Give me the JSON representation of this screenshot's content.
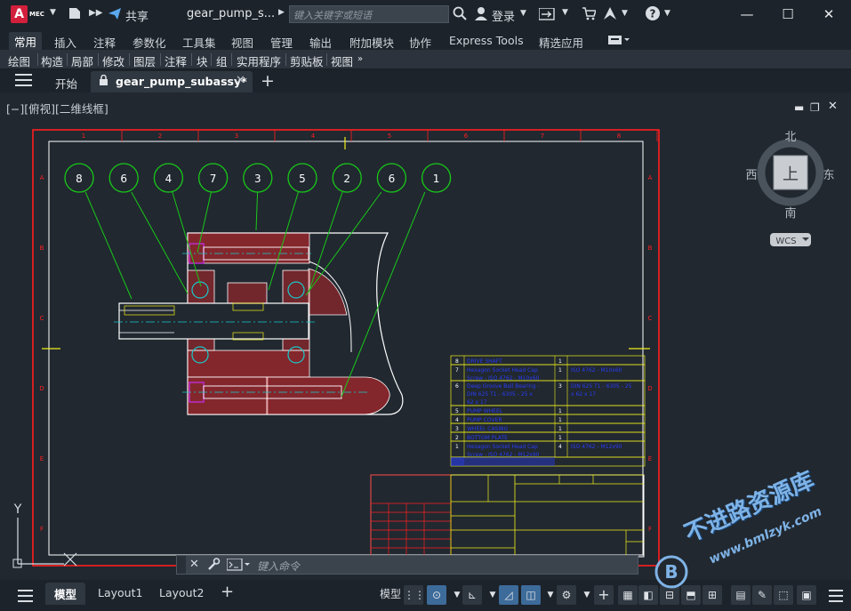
{
  "title_bar": {
    "logo_letter": "A",
    "logo_sub": "MEC",
    "share_label": "共享",
    "document_title": "gear_pump_s...",
    "search_placeholder": "键入关键字或短语",
    "login_label": "登录",
    "window_buttons": [
      "minimize-icon",
      "maximize-icon",
      "close-icon"
    ]
  },
  "ribbon": {
    "tabs": [
      "常用",
      "插入",
      "注释",
      "参数化",
      "工具集",
      "视图",
      "管理",
      "输出",
      "附加模块",
      "协作",
      "Express Tools",
      "精选应用"
    ],
    "active_tab": "常用",
    "panels": [
      "绘图",
      "构造",
      "局部",
      "修改",
      "图层",
      "注释",
      "块",
      "组",
      "实用程序",
      "剪贴板",
      "视图"
    ]
  },
  "file_tabs": {
    "start_label": "开始",
    "active_file": "gear_pump_subassy*"
  },
  "viewport": {
    "view_label": "[−][俯视][二维线框]",
    "viewcube": {
      "north": "北",
      "south": "南",
      "east": "东",
      "west": "西",
      "top_face": "上",
      "wcs_label": "WCS"
    },
    "ucs": {
      "y_label": "Y"
    },
    "balloons": [
      "8",
      "6",
      "4",
      "7",
      "3",
      "5",
      "2",
      "6",
      "1"
    ],
    "border_letters_left": [
      "A",
      "B",
      "C",
      "D",
      "E",
      "F"
    ],
    "border_numbers_top": [
      "1",
      "2",
      "3",
      "4",
      "5",
      "6",
      "7",
      "8"
    ],
    "parts_list": [
      {
        "item": "8",
        "desc": "DRIVE SHAFT",
        "qty": "1",
        "spec": ""
      },
      {
        "item": "7",
        "desc": "Hexagon Socket Head Cap Screw - ISO 4762 - M10x60",
        "qty": "1",
        "spec": "ISO 4762 - M10x60"
      },
      {
        "item": "6",
        "desc": "Deep Groove Ball Bearing - DIN 625 T1 - 6305 - 25 x 62 x 17",
        "qty": "3",
        "spec": "DIN 625 T1 - 6305 - 25 x 62 x 17"
      },
      {
        "item": "5",
        "desc": "PUMP WHEEL",
        "qty": "1",
        "spec": ""
      },
      {
        "item": "4",
        "desc": "PUMP COVER",
        "qty": "1",
        "spec": ""
      },
      {
        "item": "3",
        "desc": "WHEEL CASING",
        "qty": "1",
        "spec": ""
      },
      {
        "item": "2",
        "desc": "BOTTOM PLATE",
        "qty": "1",
        "spec": ""
      },
      {
        "item": "1",
        "desc": "Hexagon Socket Head Cap Screw - ISO 4762 - M12x90",
        "qty": "4",
        "spec": "ISO 4762 - M12x90"
      }
    ]
  },
  "command_line": {
    "placeholder": "键入命令"
  },
  "status_bar": {
    "model_tab": "模型",
    "layouts": [
      "Layout1",
      "Layout2"
    ],
    "model_space_label": "模型"
  },
  "watermark": {
    "text": "不进路资源库",
    "url": "www.bmlzyk.com"
  },
  "colors": {
    "accent_red": "#ff1f1f",
    "line_white": "#ffffff",
    "leader_green": "#19c919",
    "table_yellow": "#f0ef1a",
    "text_blue": "#2a3df5",
    "hatch_red": "#d5262b",
    "center_cyan": "#19c9c9",
    "magenta": "#c02bd6"
  }
}
